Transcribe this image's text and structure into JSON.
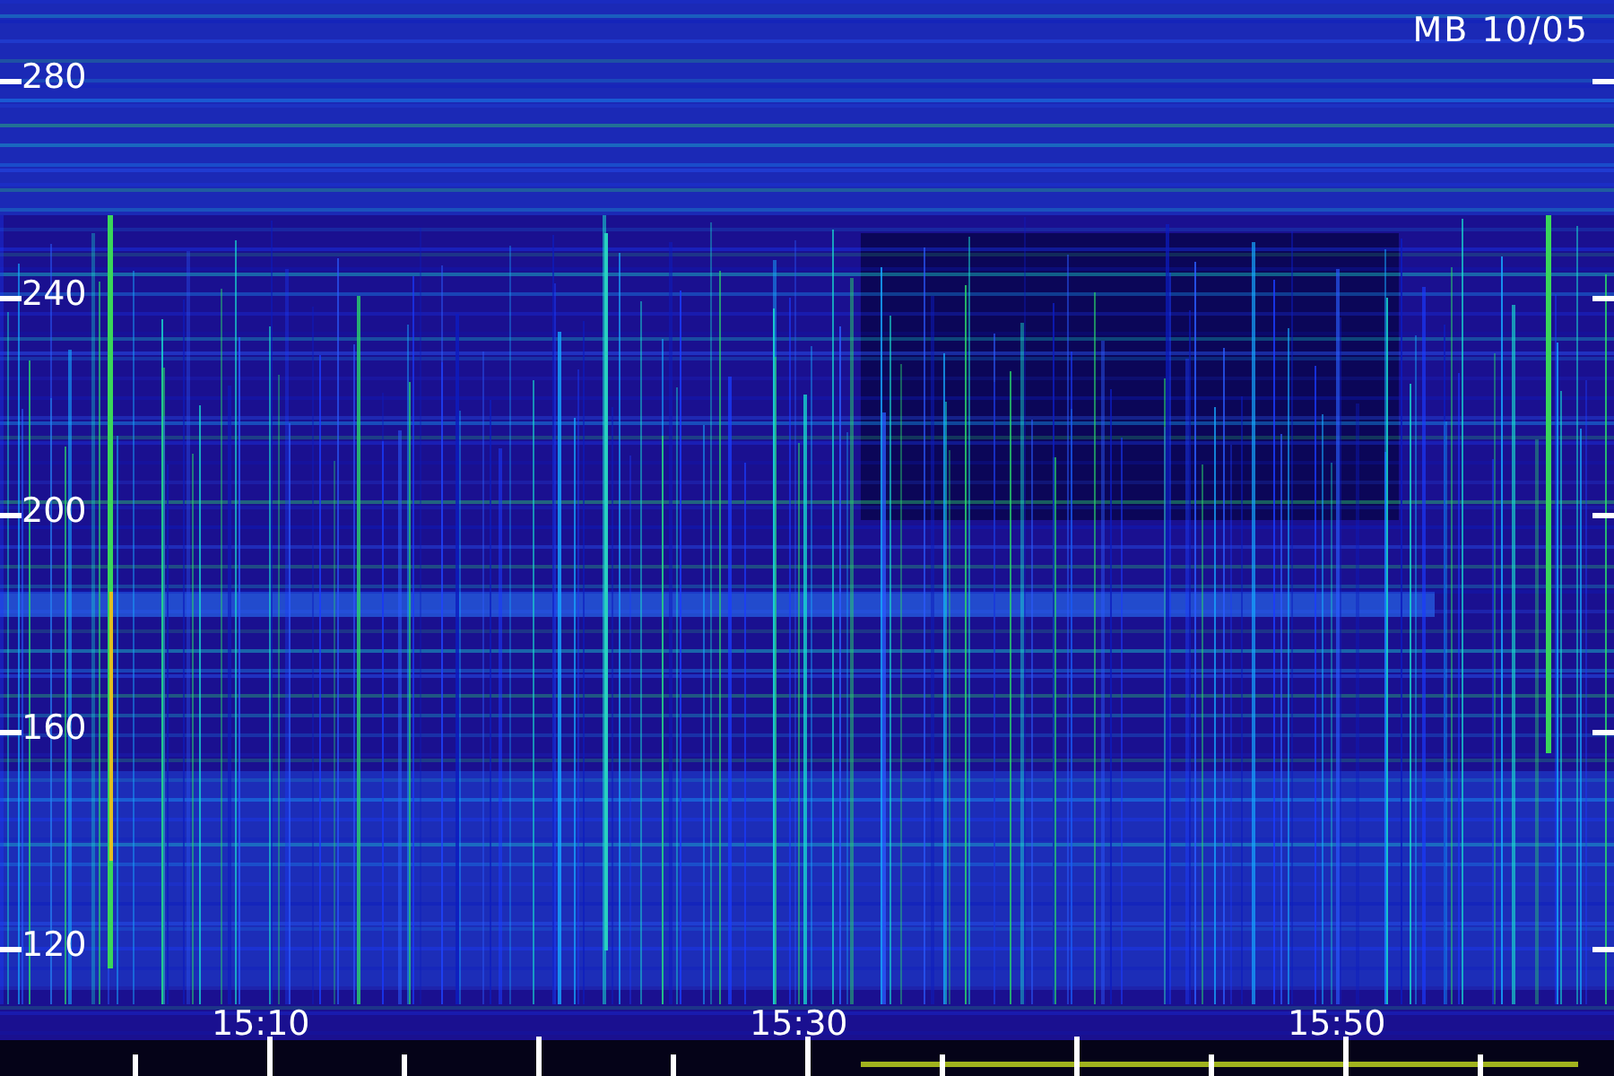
{
  "station_label": "MB 10/05",
  "frequency_axis": {
    "labels": [
      "280",
      "240",
      "200",
      "160",
      "120"
    ]
  },
  "time_axis": {
    "labels": [
      "15:10",
      "15:30",
      "15:50"
    ]
  }
}
